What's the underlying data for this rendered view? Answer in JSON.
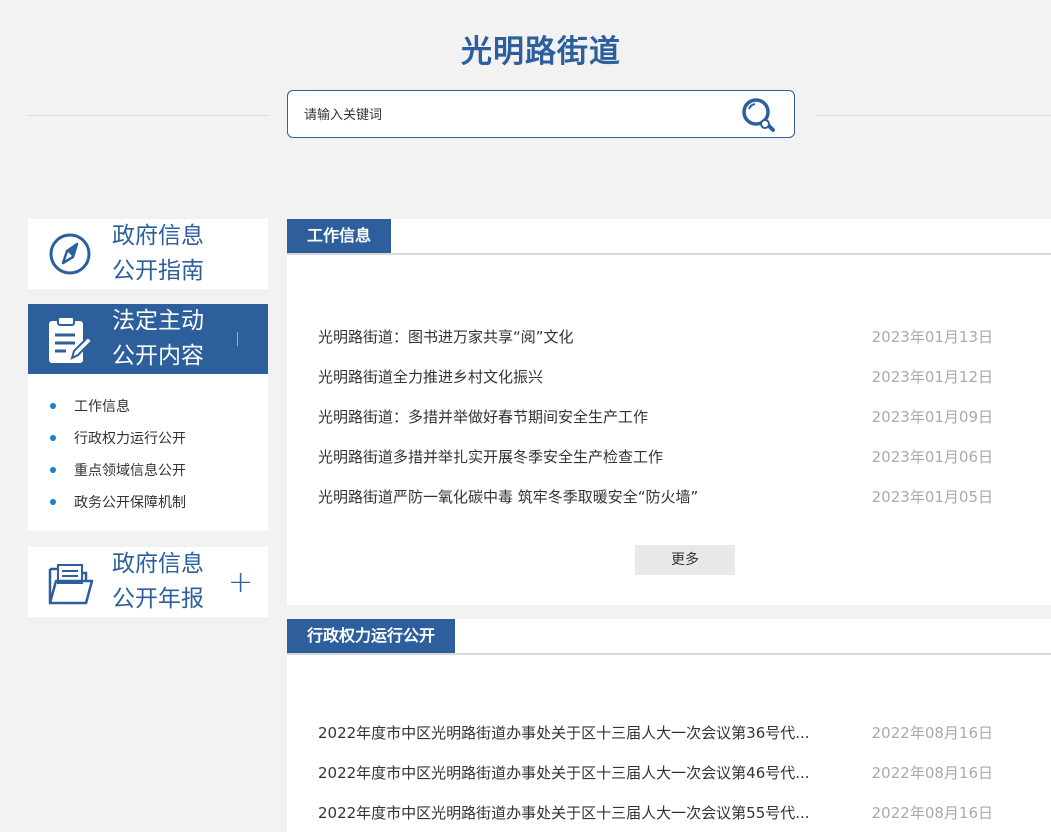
{
  "header": {
    "site_title": "光明路街道",
    "search": {
      "placeholder": "请输入关键词",
      "value": ""
    }
  },
  "sidebar": {
    "cards": [
      {
        "line1": "政府信息",
        "line2": "公开指南",
        "icon": "compass-icon"
      },
      {
        "line1": "法定主动",
        "line2": "公开内容",
        "icon": "clipboard-edit-icon",
        "active": true
      },
      {
        "line1": "政府信息",
        "line2": "公开年报",
        "icon": "folder-icon",
        "expand": "+"
      }
    ],
    "sub_items": [
      "工作信息",
      "行政权力运行公开",
      "重点领域信息公开",
      "政务公开保障机制"
    ]
  },
  "main": {
    "sections": [
      {
        "title": "工作信息",
        "items": [
          {
            "title": "光明路街道：图书进万家共享“阅”文化",
            "date": "2023年01月13日"
          },
          {
            "title": "光明路街道全力推进乡村文化振兴",
            "date": "2023年01月12日"
          },
          {
            "title": "光明路街道：多措并举做好春节期间安全生产工作",
            "date": "2023年01月09日"
          },
          {
            "title": "光明路街道多措并举扎实开展冬季安全生产检查工作",
            "date": "2023年01月06日"
          },
          {
            "title": "光明路街道严防一氧化碳中毒 筑牢冬季取暖安全“防火墙”",
            "date": "2023年01月05日"
          }
        ],
        "more_label": "更多"
      },
      {
        "title": "行政权力运行公开",
        "items": [
          {
            "title": "2022年度市中区光明路街道办事处关于区十三届人大一次会议第36号代...",
            "date": "2022年08月16日"
          },
          {
            "title": "2022年度市中区光明路街道办事处关于区十三届人大一次会议第46号代...",
            "date": "2022年08月16日"
          },
          {
            "title": "2022年度市中区光明路街道办事处关于区十三届人大一次会议第55号代...",
            "date": "2022年08月16日"
          }
        ]
      }
    ]
  },
  "colors": {
    "brand": "#2c5f9c",
    "date_text": "#aaaaaa",
    "bullet": "#1a7fd6"
  }
}
